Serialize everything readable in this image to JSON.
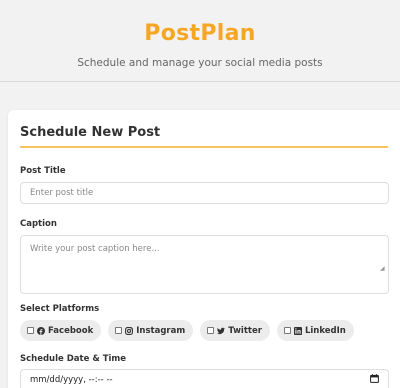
{
  "header": {
    "app_title": "PostPlan",
    "subtitle": "Schedule and manage your social media posts"
  },
  "form": {
    "title": "Schedule New Post",
    "post_title_label": "Post Title",
    "post_title_placeholder": "Enter post title",
    "post_title_value": "",
    "caption_label": "Caption",
    "caption_placeholder": "Write your post caption here...",
    "caption_value": "",
    "platforms_label": "Select Platforms",
    "platforms": [
      {
        "label": "Facebook",
        "icon": "facebook-icon",
        "checked": false
      },
      {
        "label": "Instagram",
        "icon": "instagram-icon",
        "checked": false
      },
      {
        "label": "Twitter",
        "icon": "twitter-icon",
        "checked": false
      },
      {
        "label": "LinkedIn",
        "icon": "linkedin-icon",
        "checked": false
      }
    ],
    "date_label": "Schedule Date & Time",
    "date_value": "mm/dd/yyyy, --:-- --"
  },
  "colors": {
    "brand": "#f5a623",
    "accent_rule": "#f7c35f",
    "background": "#f2f2f2",
    "card": "#ffffff",
    "chip": "#ececec"
  }
}
